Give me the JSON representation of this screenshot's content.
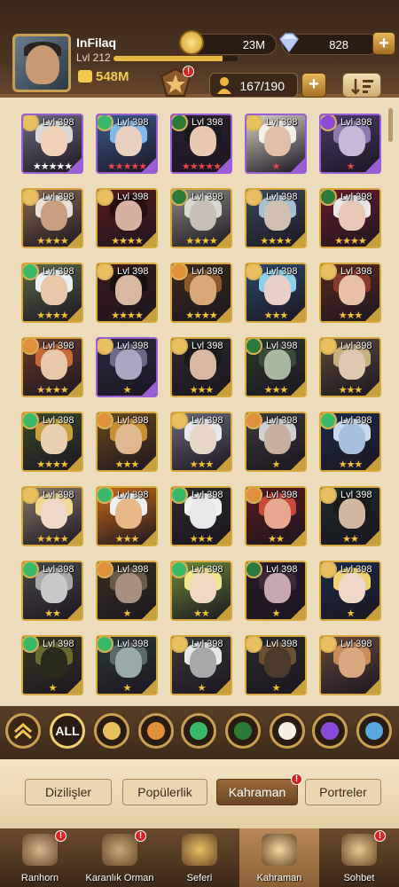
{
  "player": {
    "name": "InFilaq",
    "level": "Lvl 212",
    "xp_fraction": 0.88,
    "power": "548M"
  },
  "resources": {
    "gold": "23M",
    "diamonds": "828"
  },
  "hero_count": "167/190",
  "colors": {
    "gold_star": "#f2c230",
    "red_star": "#e8424a",
    "white_star": "#ffffff",
    "badge_red": "#d92323",
    "frame_gold": "#d7a93e",
    "frame_purple": "#9a5fd4"
  },
  "heroes": [
    {
      "level": "Lvl 398",
      "stars": "★★★★★",
      "star_color": "white",
      "faction": "lightbearer",
      "tier": "purple",
      "palette": [
        "#6d6b7e",
        "#d9d9d9",
        "#f0d2b8"
      ]
    },
    {
      "level": "Lvl 398",
      "stars": "★★★★★",
      "star_color": "red",
      "faction": "wilder",
      "tier": "purple",
      "palette": [
        "#3a5a8c",
        "#7fb8e8",
        "#e8d0c0"
      ]
    },
    {
      "level": "Lvl 398",
      "stars": "★★★★★",
      "star_color": "red",
      "faction": "graveborn",
      "tier": "purple",
      "palette": [
        "#2a2030",
        "#1a1a20",
        "#e8c8b0"
      ]
    },
    {
      "level": "Lvl 398",
      "stars": "★",
      "star_color": "red",
      "faction": "lightbearer",
      "tier": "purple",
      "palette": [
        "#d8d0c8",
        "#f2efe8",
        "#e0c0a8"
      ]
    },
    {
      "level": "Lvl 398",
      "stars": "★",
      "star_color": "red",
      "faction": "hypogean",
      "tier": "purple",
      "palette": [
        "#4a3a6a",
        "#8a7ab0",
        "#c8b8d8"
      ]
    },
    {
      "level": "Lvl 398",
      "stars": "★★★★",
      "star_color": "gold",
      "faction": "lightbearer",
      "tier": "gold",
      "palette": [
        "#8a6a50",
        "#e8e0d8",
        "#c8a080"
      ]
    },
    {
      "level": "Lvl 398",
      "stars": "★★★★",
      "star_color": "gold",
      "faction": "lightbearer",
      "tier": "gold",
      "palette": [
        "#5a1a1a",
        "#2a1010",
        "#d8b0a0"
      ]
    },
    {
      "level": "Lvl 398",
      "stars": "★★★★",
      "star_color": "gold",
      "faction": "graveborn",
      "tier": "gold",
      "palette": [
        "#8a8a80",
        "#d8d8d0",
        "#c8c0b8"
      ]
    },
    {
      "level": "Lvl 398",
      "stars": "★★★★",
      "star_color": "gold",
      "faction": "lightbearer",
      "tier": "gold",
      "palette": [
        "#3a4a5a",
        "#a8c0d0",
        "#d0c0b0"
      ]
    },
    {
      "level": "Lvl 398",
      "stars": "★★★★",
      "star_color": "gold",
      "faction": "graveborn",
      "tier": "gold",
      "palette": [
        "#6a1a2a",
        "#e8e8e8",
        "#e8c8b8"
      ]
    },
    {
      "level": "Lvl 398",
      "stars": "★★★★",
      "star_color": "gold",
      "faction": "wilder",
      "tier": "gold",
      "palette": [
        "#5a6a4a",
        "#e8f0f0",
        "#e8c8a8"
      ]
    },
    {
      "level": "Lvl 398",
      "stars": "★★★★",
      "star_color": "gold",
      "faction": "lightbearer",
      "tier": "gold",
      "palette": [
        "#3a1a1a",
        "#1a1010",
        "#d8b8a0"
      ]
    },
    {
      "level": "Lvl 398",
      "stars": "★★★★",
      "star_color": "gold",
      "faction": "mauler",
      "tier": "gold",
      "palette": [
        "#3a2a1a",
        "#8a5a2a",
        "#d8a878"
      ]
    },
    {
      "level": "Lvl 398",
      "stars": "★★★",
      "star_color": "gold",
      "faction": "lightbearer",
      "tier": "gold",
      "palette": [
        "#2a4a6a",
        "#8ad0e8",
        "#e8d0c8"
      ]
    },
    {
      "level": "Lvl 398",
      "stars": "★★★",
      "star_color": "gold",
      "faction": "lightbearer",
      "tier": "gold",
      "palette": [
        "#5a2a1a",
        "#8a3a2a",
        "#e8c0a8"
      ]
    },
    {
      "level": "Lvl 398",
      "stars": "★★★★",
      "star_color": "gold",
      "faction": "mauler",
      "tier": "gold",
      "palette": [
        "#6a3a2a",
        "#c86a3a",
        "#e8c8a8"
      ]
    },
    {
      "level": "Lvl 398",
      "stars": "★",
      "star_color": "gold",
      "faction": "lightbearer",
      "tier": "purple",
      "palette": [
        "#2a2a40",
        "#6a6a88",
        "#a8a8c0"
      ]
    },
    {
      "level": "Lvl 398",
      "stars": "★★★",
      "star_color": "gold",
      "faction": "lightbearer",
      "tier": "gold",
      "palette": [
        "#2a2a2a",
        "#1a1a1a",
        "#d8b8a0"
      ]
    },
    {
      "level": "Lvl 398",
      "stars": "★★★",
      "star_color": "gold",
      "faction": "graveborn",
      "tier": "gold",
      "palette": [
        "#2a3a2a",
        "#3a4a3a",
        "#a8b8a0"
      ]
    },
    {
      "level": "Lvl 398",
      "stars": "★★★",
      "star_color": "gold",
      "faction": "lightbearer",
      "tier": "gold",
      "palette": [
        "#5a4a3a",
        "#c8b080",
        "#e0c8b0"
      ]
    },
    {
      "level": "Lvl 398",
      "stars": "★★★★",
      "star_color": "gold",
      "faction": "wilder",
      "tier": "gold",
      "palette": [
        "#3a4a2a",
        "#c8a040",
        "#e8d0b0"
      ]
    },
    {
      "level": "Lvl 398",
      "stars": "★★★",
      "star_color": "gold",
      "faction": "mauler",
      "tier": "gold",
      "palette": [
        "#6a4a1a",
        "#c89030",
        "#e0b890"
      ]
    },
    {
      "level": "Lvl 398",
      "stars": "★★★",
      "star_color": "gold",
      "faction": "lightbearer",
      "tier": "gold",
      "palette": [
        "#6a6a7a",
        "#e8e8f0",
        "#e8d8c8"
      ]
    },
    {
      "level": "Lvl 398",
      "stars": "★",
      "star_color": "gold",
      "faction": "mauler",
      "tier": "gold",
      "palette": [
        "#3a3a3a",
        "#d0d0d0",
        "#c8b0a0"
      ]
    },
    {
      "level": "Lvl 398",
      "stars": "★★★",
      "star_color": "gold",
      "faction": "wilder",
      "tier": "gold",
      "palette": [
        "#1a2a4a",
        "#c8d8f0",
        "#a8c0e0"
      ]
    },
    {
      "level": "Lvl 398",
      "stars": "★★★★",
      "star_color": "gold",
      "faction": "lightbearer",
      "tier": "gold",
      "palette": [
        "#8a7a6a",
        "#f0d890",
        "#f0d8c8"
      ]
    },
    {
      "level": "Lvl 398",
      "stars": "★★★",
      "star_color": "gold",
      "faction": "wilder",
      "tier": "gold",
      "palette": [
        "#c86a1a",
        "#f0f0f0",
        "#e8b888"
      ]
    },
    {
      "level": "Lvl 398",
      "stars": "★★★",
      "star_color": "gold",
      "faction": "wilder",
      "tier": "gold",
      "palette": [
        "#2a2a2a",
        "#f0f0f0",
        "#e8e8e8"
      ]
    },
    {
      "level": "Lvl 398",
      "stars": "★★",
      "star_color": "gold",
      "faction": "mauler",
      "tier": "gold",
      "palette": [
        "#5a1a1a",
        "#c84a3a",
        "#e8a890"
      ]
    },
    {
      "level": "Lvl 398",
      "stars": "★★",
      "star_color": "gold",
      "faction": "lightbearer",
      "tier": "gold",
      "palette": [
        "#1a2a2a",
        "#1a1a1a",
        "#d0b8a0"
      ]
    },
    {
      "level": "Lvl 398",
      "stars": "★★",
      "star_color": "gold",
      "faction": "wilder",
      "tier": "gold",
      "palette": [
        "#4a4a4a",
        "#a8a8a8",
        "#c8c8c8"
      ]
    },
    {
      "level": "Lvl 398",
      "stars": "★",
      "star_color": "gold",
      "faction": "mauler",
      "tier": "gold",
      "palette": [
        "#3a3020",
        "#6a5a4a",
        "#a89080"
      ]
    },
    {
      "level": "Lvl 398",
      "stars": "★★",
      "star_color": "gold",
      "faction": "wilder",
      "tier": "gold",
      "palette": [
        "#6a8a3a",
        "#f0e890",
        "#f0d8c0"
      ]
    },
    {
      "level": "Lvl 398",
      "stars": "★",
      "star_color": "gold",
      "faction": "graveborn",
      "tier": "gold",
      "palette": [
        "#2a1a2a",
        "#3a2a3a",
        "#c8a8b0"
      ]
    },
    {
      "level": "Lvl 398",
      "stars": "★",
      "star_color": "gold",
      "faction": "lightbearer",
      "tier": "gold",
      "palette": [
        "#1a2a4a",
        "#f0d070",
        "#f0d8c8"
      ]
    },
    {
      "level": "Lvl 398",
      "stars": "★",
      "star_color": "gold",
      "faction": "wilder",
      "tier": "gold",
      "palette": [
        "#3a3a20",
        "#6a6a30",
        "#2a2a1a"
      ]
    },
    {
      "level": "Lvl 398",
      "stars": "★",
      "star_color": "gold",
      "faction": "wilder",
      "tier": "gold",
      "palette": [
        "#2a3a3a",
        "#5a6a6a",
        "#9aaaa8"
      ]
    },
    {
      "level": "Lvl 398",
      "stars": "★",
      "star_color": "gold",
      "faction": "lightbearer",
      "tier": "gold",
      "palette": [
        "#3a3a3a",
        "#e8e8e8",
        "#a8a8a8"
      ]
    },
    {
      "level": "Lvl 398",
      "stars": "★",
      "star_color": "gold",
      "faction": "lightbearer",
      "tier": "gold",
      "palette": [
        "#2a2a2a",
        "#6a5030",
        "#4a3a2a"
      ]
    },
    {
      "level": "Lvl 398",
      "stars": "",
      "star_color": "gold",
      "faction": "lightbearer",
      "tier": "gold",
      "palette": [
        "#6a4a3a",
        "#c88a5a",
        "#d8a880"
      ]
    }
  ],
  "faction_filters": [
    {
      "name": "collapse",
      "label": ""
    },
    {
      "name": "all",
      "label": "ALL"
    },
    {
      "name": "lightbearer",
      "label": ""
    },
    {
      "name": "mauler",
      "label": ""
    },
    {
      "name": "wilder",
      "label": ""
    },
    {
      "name": "graveborn",
      "label": ""
    },
    {
      "name": "celestial",
      "label": ""
    },
    {
      "name": "hypogean",
      "label": ""
    },
    {
      "name": "dimensional",
      "label": ""
    }
  ],
  "subtabs": [
    {
      "label": "Dizilişler",
      "active": false,
      "badge": false
    },
    {
      "label": "Popülerlik",
      "active": false,
      "badge": false
    },
    {
      "label": "Kahraman",
      "active": true,
      "badge": true
    },
    {
      "label": "Portreler",
      "active": false,
      "badge": false
    }
  ],
  "nav": [
    {
      "label": "Ranhorn",
      "active": false,
      "badge": true
    },
    {
      "label": "Karanlık Orman",
      "active": false,
      "badge": true
    },
    {
      "label": "Seferi",
      "active": false,
      "badge": false
    },
    {
      "label": "Kahraman",
      "active": true,
      "badge": false
    },
    {
      "label": "Sohbet",
      "active": false,
      "badge": true
    }
  ]
}
